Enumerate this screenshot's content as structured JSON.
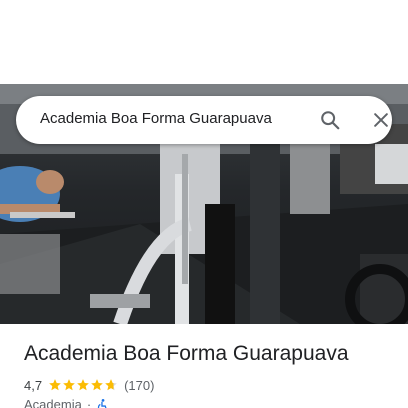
{
  "search": {
    "query": "Academia Boa Forma Guarapuava",
    "search_icon": "search-icon",
    "close_icon": "close-icon"
  },
  "photo": {
    "subject": "gym-interior-photo"
  },
  "place": {
    "title": "Academia Boa Forma Guarapuava",
    "rating": "4,7",
    "rating_value": 4.7,
    "review_count": "(170)",
    "category": "Academia",
    "separator": "·",
    "accessibility_icon": "wheelchair-icon"
  },
  "colors": {
    "star": "#fbbc04",
    "accessibility": "#1a73e8",
    "text_primary": "#202124",
    "text_secondary": "#5f6368"
  }
}
